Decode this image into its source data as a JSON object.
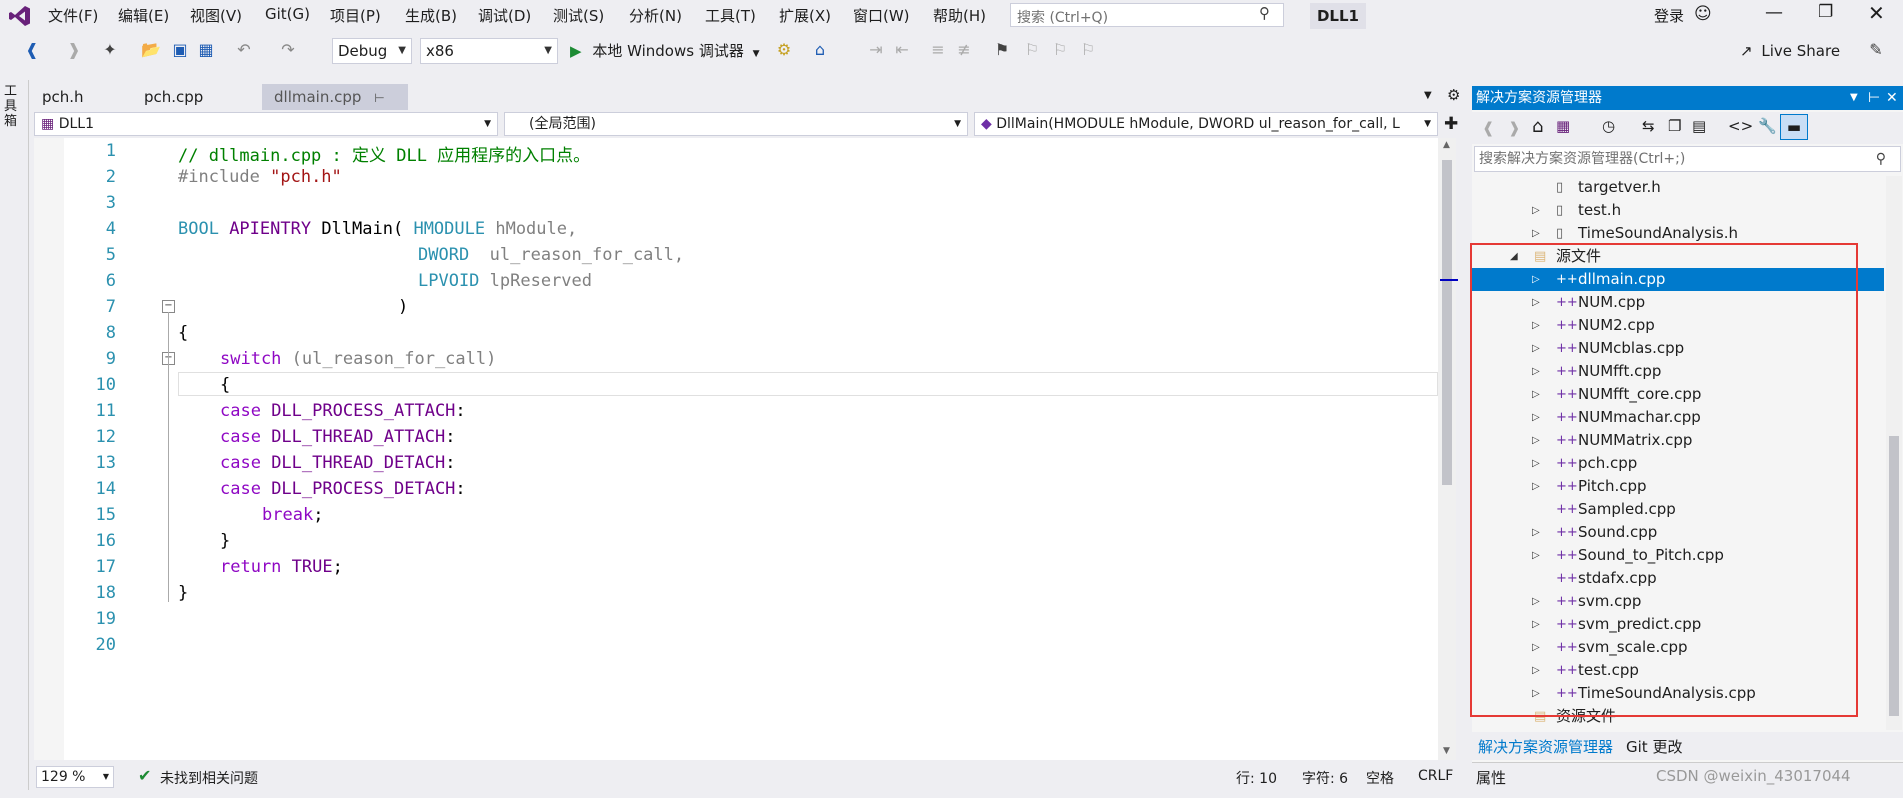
{
  "menubar": {
    "items": [
      "文件(F)",
      "编辑(E)",
      "视图(V)",
      "Git(G)",
      "项目(P)",
      "生成(B)",
      "调试(D)",
      "测试(S)",
      "分析(N)",
      "工具(T)",
      "扩展(X)",
      "窗口(W)",
      "帮助(H)"
    ],
    "search_placeholder": "搜索 (Ctrl+Q)",
    "solution_name": "DLL1",
    "login": "登录"
  },
  "toolbar": {
    "config": "Debug",
    "platform": "x86",
    "run_label": "本地 Windows 调试器",
    "live_share": "Live Share"
  },
  "left_strip": {
    "label": "工具箱"
  },
  "tabs": [
    "pch.h",
    "pch.cpp",
    "dllmain.cpp"
  ],
  "nav": {
    "project": "DLL1",
    "scope": "(全局范围)",
    "member": "DllMain(HMODULE hModule, DWORD ul_reason_for_call, L"
  },
  "editor": {
    "line_numbers": [
      "1",
      "2",
      "3",
      "4",
      "5",
      "6",
      "7",
      "8",
      "9",
      "10",
      "11",
      "12",
      "13",
      "14",
      "15",
      "16",
      "17",
      "18",
      "19",
      "20"
    ],
    "code": {
      "l1": "// dllmain.cpp : 定义 DLL 应用程序的入口点。",
      "l2a": "#include ",
      "l2b": "\"pch.h\"",
      "l4a": "BOOL",
      "l4b": " APIENTRY ",
      "l4c": "DllMain",
      "l4d": "( ",
      "l4e": "HMODULE",
      "l4f": " hModule,",
      "l5a": "DWORD",
      "l5b": "  ul_reason_for_call,",
      "l6a": "LPVOID",
      "l6b": " lpReserved",
      "l7": ")",
      "l8": "{",
      "l9a": "switch",
      "l9b": " (ul_reason_for_call)",
      "l10": "{",
      "l11a": "case",
      "l11b": " DLL_PROCESS_ATTACH",
      "l11c": ":",
      "l12a": "case",
      "l12b": " DLL_THREAD_ATTACH",
      "l12c": ":",
      "l13a": "case",
      "l13b": " DLL_THREAD_DETACH",
      "l13c": ":",
      "l14a": "case",
      "l14b": " DLL_PROCESS_DETACH",
      "l14c": ":",
      "l15a": "break",
      "l15b": ";",
      "l16": "}",
      "l17a": "return",
      "l17b": " TRUE",
      "l17c": ";",
      "l18": "}"
    }
  },
  "status": {
    "zoom": "129 %",
    "issues": "未找到相关问题",
    "line": "行: 10",
    "char": "字符: 6",
    "spaces": "空格",
    "eol": "CRLF"
  },
  "solution_explorer": {
    "title": "解决方案资源管理器",
    "search_placeholder": "搜索解决方案资源管理器(Ctrl+;)",
    "rows": [
      {
        "label": "targetver.h",
        "type": "header",
        "expander": false
      },
      {
        "label": "test.h",
        "type": "header",
        "expander": true
      },
      {
        "label": "TimeSoundAnalysis.h",
        "type": "header",
        "expander": true
      },
      {
        "label": "源文件",
        "type": "folder",
        "expander": true
      },
      {
        "label": "dllmain.cpp",
        "type": "cpp",
        "expander": true,
        "selected": true
      },
      {
        "label": "NUM.cpp",
        "type": "cpp",
        "expander": true
      },
      {
        "label": "NUM2.cpp",
        "type": "cpp",
        "expander": true
      },
      {
        "label": "NUMcblas.cpp",
        "type": "cpp",
        "expander": true
      },
      {
        "label": "NUMfft.cpp",
        "type": "cpp",
        "expander": true
      },
      {
        "label": "NUMfft_core.cpp",
        "type": "cpp",
        "expander": true
      },
      {
        "label": "NUMmachar.cpp",
        "type": "cpp",
        "expander": true
      },
      {
        "label": "NUMMatrix.cpp",
        "type": "cpp",
        "expander": true
      },
      {
        "label": "pch.cpp",
        "type": "cpp",
        "expander": true
      },
      {
        "label": "Pitch.cpp",
        "type": "cpp",
        "expander": true
      },
      {
        "label": "Sampled.cpp",
        "type": "cpp",
        "expander": false
      },
      {
        "label": "Sound.cpp",
        "type": "cpp",
        "expander": true
      },
      {
        "label": "Sound_to_Pitch.cpp",
        "type": "cpp",
        "expander": true
      },
      {
        "label": "stdafx.cpp",
        "type": "cpp",
        "expander": false
      },
      {
        "label": "svm.cpp",
        "type": "cpp",
        "expander": true
      },
      {
        "label": "svm_predict.cpp",
        "type": "cpp",
        "expander": true
      },
      {
        "label": "svm_scale.cpp",
        "type": "cpp",
        "expander": true
      },
      {
        "label": "test.cpp",
        "type": "cpp",
        "expander": true
      },
      {
        "label": "TimeSoundAnalysis.cpp",
        "type": "cpp",
        "expander": true
      },
      {
        "label": "资源文件",
        "type": "folder",
        "expander": false
      }
    ],
    "bottom_tabs": [
      "解决方案资源管理器",
      "Git 更改"
    ],
    "properties": "属性"
  },
  "watermark": "CSDN @weixin_43017044",
  "colors": {
    "accent": "#007ACC",
    "highlight_box": "#E53935"
  }
}
